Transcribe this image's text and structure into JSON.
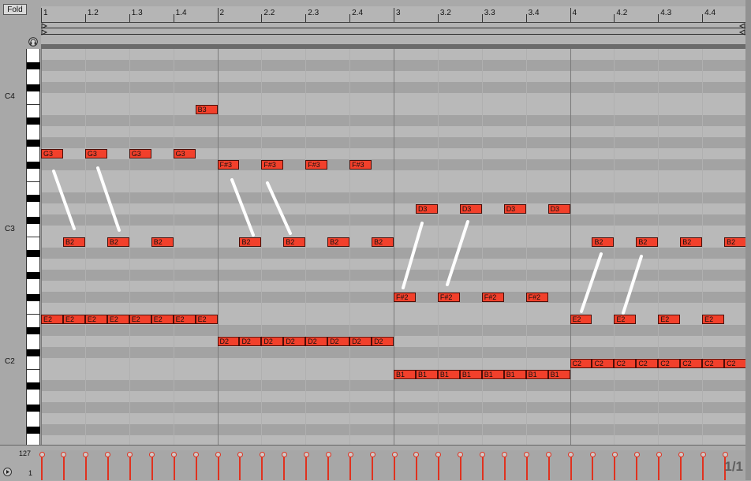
{
  "header": {
    "fold_label": "Fold",
    "ruler_ticks": [
      "1",
      "1.2",
      "1.3",
      "1.4",
      "2",
      "2.2",
      "2.3",
      "2.4",
      "3",
      "3.2",
      "3.3",
      "3.4",
      "4",
      "4.2",
      "4.3",
      "4.4"
    ]
  },
  "keyboard": {
    "octave_labels": [
      "C4",
      "C3",
      "C2"
    ]
  },
  "notes": [
    {
      "pitch": "G3",
      "bar_start": 1.0,
      "len": 0.125
    },
    {
      "pitch": "G3",
      "bar_start": 1.25,
      "len": 0.125
    },
    {
      "pitch": "G3",
      "bar_start": 1.5,
      "len": 0.125
    },
    {
      "pitch": "G3",
      "bar_start": 1.75,
      "len": 0.125
    },
    {
      "pitch": "B3",
      "bar_start": 1.875,
      "len": 0.125
    },
    {
      "pitch": "B2",
      "bar_start": 1.125,
      "len": 0.125
    },
    {
      "pitch": "B2",
      "bar_start": 1.375,
      "len": 0.125
    },
    {
      "pitch": "B2",
      "bar_start": 1.625,
      "len": 0.125
    },
    {
      "pitch": "E2",
      "bar_start": 1.0,
      "len": 0.125
    },
    {
      "pitch": "E2",
      "bar_start": 1.125,
      "len": 0.125
    },
    {
      "pitch": "E2",
      "bar_start": 1.25,
      "len": 0.125
    },
    {
      "pitch": "E2",
      "bar_start": 1.375,
      "len": 0.125
    },
    {
      "pitch": "E2",
      "bar_start": 1.5,
      "len": 0.125
    },
    {
      "pitch": "E2",
      "bar_start": 1.625,
      "len": 0.125
    },
    {
      "pitch": "E2",
      "bar_start": 1.75,
      "len": 0.125
    },
    {
      "pitch": "E2",
      "bar_start": 1.875,
      "len": 0.125
    },
    {
      "pitch": "F#3",
      "bar_start": 2.0,
      "len": 0.125
    },
    {
      "pitch": "F#3",
      "bar_start": 2.25,
      "len": 0.125
    },
    {
      "pitch": "F#3",
      "bar_start": 2.5,
      "len": 0.125
    },
    {
      "pitch": "F#3",
      "bar_start": 2.75,
      "len": 0.125
    },
    {
      "pitch": "B2",
      "bar_start": 2.125,
      "len": 0.125
    },
    {
      "pitch": "B2",
      "bar_start": 2.375,
      "len": 0.125
    },
    {
      "pitch": "B2",
      "bar_start": 2.625,
      "len": 0.125
    },
    {
      "pitch": "B2",
      "bar_start": 2.875,
      "len": 0.125
    },
    {
      "pitch": "D2",
      "bar_start": 2.0,
      "len": 0.125
    },
    {
      "pitch": "D2",
      "bar_start": 2.125,
      "len": 0.125
    },
    {
      "pitch": "D2",
      "bar_start": 2.25,
      "len": 0.125
    },
    {
      "pitch": "D2",
      "bar_start": 2.375,
      "len": 0.125
    },
    {
      "pitch": "D2",
      "bar_start": 2.5,
      "len": 0.125
    },
    {
      "pitch": "D2",
      "bar_start": 2.625,
      "len": 0.125
    },
    {
      "pitch": "D2",
      "bar_start": 2.75,
      "len": 0.125
    },
    {
      "pitch": "D2",
      "bar_start": 2.875,
      "len": 0.125
    },
    {
      "pitch": "D3",
      "bar_start": 3.125,
      "len": 0.125
    },
    {
      "pitch": "D3",
      "bar_start": 3.375,
      "len": 0.125
    },
    {
      "pitch": "D3",
      "bar_start": 3.625,
      "len": 0.125
    },
    {
      "pitch": "D3",
      "bar_start": 3.875,
      "len": 0.125
    },
    {
      "pitch": "F#2",
      "bar_start": 3.0,
      "len": 0.125
    },
    {
      "pitch": "F#2",
      "bar_start": 3.25,
      "len": 0.125
    },
    {
      "pitch": "F#2",
      "bar_start": 3.5,
      "len": 0.125
    },
    {
      "pitch": "F#2",
      "bar_start": 3.75,
      "len": 0.125
    },
    {
      "pitch": "B1",
      "bar_start": 3.0,
      "len": 0.125
    },
    {
      "pitch": "B1",
      "bar_start": 3.125,
      "len": 0.125
    },
    {
      "pitch": "B1",
      "bar_start": 3.25,
      "len": 0.125
    },
    {
      "pitch": "B1",
      "bar_start": 3.375,
      "len": 0.125
    },
    {
      "pitch": "B1",
      "bar_start": 3.5,
      "len": 0.125
    },
    {
      "pitch": "B1",
      "bar_start": 3.625,
      "len": 0.125
    },
    {
      "pitch": "B1",
      "bar_start": 3.75,
      "len": 0.125
    },
    {
      "pitch": "B1",
      "bar_start": 3.875,
      "len": 0.125
    },
    {
      "pitch": "B2",
      "bar_start": 4.125,
      "len": 0.125
    },
    {
      "pitch": "B2",
      "bar_start": 4.375,
      "len": 0.125
    },
    {
      "pitch": "B2",
      "bar_start": 4.625,
      "len": 0.125
    },
    {
      "pitch": "B2",
      "bar_start": 4.875,
      "len": 0.125
    },
    {
      "pitch": "E2",
      "bar_start": 4.0,
      "len": 0.125
    },
    {
      "pitch": "E2",
      "bar_start": 4.25,
      "len": 0.125
    },
    {
      "pitch": "E2",
      "bar_start": 4.5,
      "len": 0.125
    },
    {
      "pitch": "E2",
      "bar_start": 4.75,
      "len": 0.125
    },
    {
      "pitch": "C2",
      "bar_start": 4.0,
      "len": 0.125
    },
    {
      "pitch": "C2",
      "bar_start": 4.125,
      "len": 0.125
    },
    {
      "pitch": "C2",
      "bar_start": 4.25,
      "len": 0.125
    },
    {
      "pitch": "C2",
      "bar_start": 4.375,
      "len": 0.125
    },
    {
      "pitch": "C2",
      "bar_start": 4.5,
      "len": 0.125
    },
    {
      "pitch": "C2",
      "bar_start": 4.625,
      "len": 0.125
    },
    {
      "pitch": "C2",
      "bar_start": 4.75,
      "len": 0.125
    },
    {
      "pitch": "C2",
      "bar_start": 4.875,
      "len": 0.125
    }
  ],
  "velocity": {
    "max_label": "127",
    "min_label": "1",
    "value": 127
  },
  "footer": {
    "page_count": "1/1"
  },
  "colors": {
    "note_fill": "#f2402b",
    "velocity_stem": "#e0321f",
    "annotation_stroke": "#ffffff"
  }
}
